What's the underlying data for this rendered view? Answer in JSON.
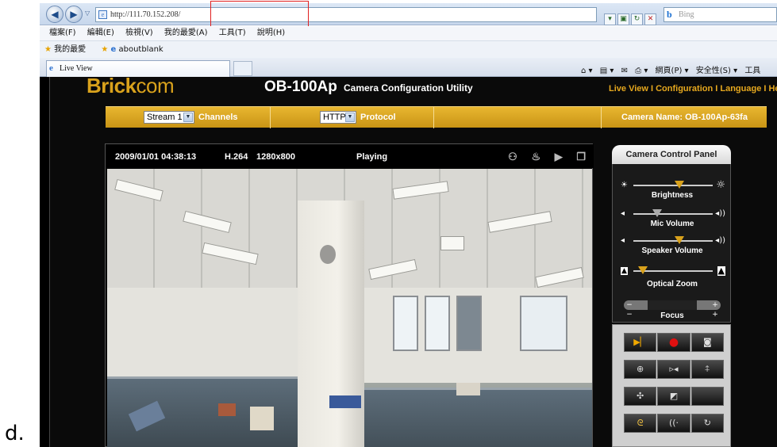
{
  "figure_label": "d.",
  "browser": {
    "url": "http://111.70.152.208/",
    "search_placeholder": "Bing",
    "menu": [
      "檔案(F)",
      "編輯(E)",
      "檢視(V)",
      "我的最愛(A)",
      "工具(T)",
      "說明(H)"
    ],
    "favorites_label": "我的最愛",
    "favorite_link": "aboutblank",
    "tab_title": "Live View",
    "cmd_items": [
      "網頁(P) ▾",
      "安全性(S) ▾",
      "工具"
    ]
  },
  "app": {
    "logo_main": "Brick",
    "logo_suffix": "com",
    "model": "OB-100Ap",
    "utility_title": "Camera Configuration Utility",
    "top_nav": "Live View I Configuration I Language I Help",
    "stream_select": "Stream 1",
    "channels_label": "Channels",
    "protocol_select": "HTTP",
    "protocol_label": "Protocol",
    "camera_name": "Camera Name: OB-100Ap-63fa"
  },
  "video": {
    "timestamp": "2009/01/01 04:38:13",
    "codec": "H.264",
    "resolution": "1280x800",
    "status": "Playing"
  },
  "control_panel": {
    "title": "Camera Control Panel",
    "sliders": [
      {
        "label": "Brightness",
        "level": 0.58
      },
      {
        "label": "Mic Volume",
        "level": 0.3
      },
      {
        "label": "Speaker Volume",
        "level": 0.58
      },
      {
        "label": "Optical Zoom",
        "level": 0.12
      }
    ],
    "focus_label": "Focus"
  }
}
